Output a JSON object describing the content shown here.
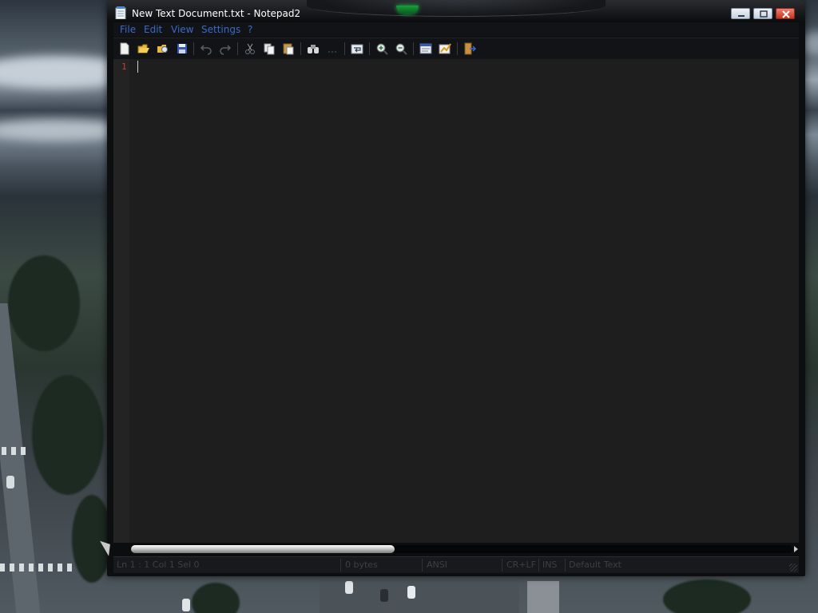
{
  "window": {
    "title": "New Text Document.txt - Notepad2",
    "minimize_label": "Minimize",
    "maximize_label": "Maximize",
    "close_label": "Close"
  },
  "menu": [
    "File",
    "Edit",
    "View",
    "Settings",
    "?"
  ],
  "toolbar": {
    "buttons": [
      {
        "name": "new-file-icon",
        "tooltip": "New"
      },
      {
        "name": "open-file-icon",
        "tooltip": "Open"
      },
      {
        "name": "browse-icon",
        "tooltip": "Browse"
      },
      {
        "name": "save-icon",
        "tooltip": "Save"
      },
      {
        "name": "undo-icon",
        "tooltip": "Undo"
      },
      {
        "name": "redo-icon",
        "tooltip": "Redo"
      },
      {
        "name": "cut-icon",
        "tooltip": "Cut"
      },
      {
        "name": "copy-icon",
        "tooltip": "Copy"
      },
      {
        "name": "paste-icon",
        "tooltip": "Paste"
      },
      {
        "name": "find-icon",
        "tooltip": "Find"
      },
      {
        "name": "replace-icon",
        "tooltip": "Replace"
      },
      {
        "name": "word-wrap-icon",
        "tooltip": "Word Wrap"
      },
      {
        "name": "zoom-in-icon",
        "tooltip": "Zoom In"
      },
      {
        "name": "zoom-out-icon",
        "tooltip": "Zoom Out"
      },
      {
        "name": "scheme-icon",
        "tooltip": "Select Scheme"
      },
      {
        "name": "customize-scheme-icon",
        "tooltip": "Customize Schemes"
      },
      {
        "name": "exit-icon",
        "tooltip": "Exit"
      }
    ]
  },
  "editor": {
    "line_numbers": [
      "1"
    ],
    "content": ""
  },
  "statusbar": {
    "position": "Ln 1 : 1   Col 1   Sel 0",
    "size": "0 bytes",
    "encoding": "ANSI",
    "line_endings": "CR+LF",
    "insert_mode": "INS",
    "scheme": "Default Text"
  },
  "colors": {
    "menu_text": "#3a6bc8",
    "editor_bg": "#1e1e1e",
    "line_number": "#d23b2c",
    "status_text": "#3c3f44",
    "title_gem": "#16a03a"
  }
}
